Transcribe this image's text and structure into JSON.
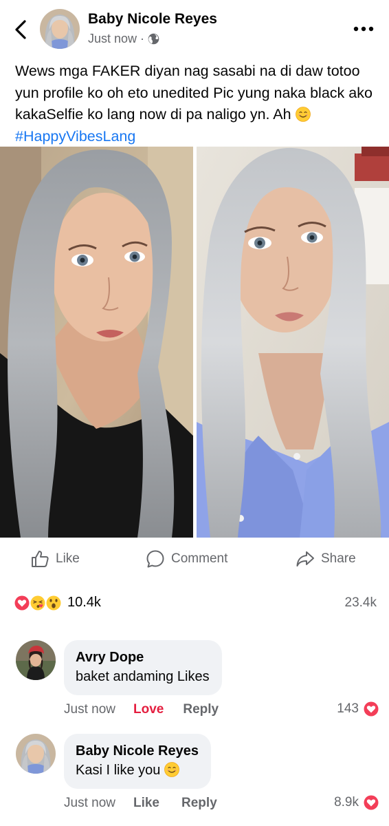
{
  "post": {
    "author_name": "Baby Nicole Reyes",
    "timestamp": "Just now",
    "separator": "·",
    "audience_icon": "globe-icon",
    "text_main": "Wews mga FAKER diyan nag sasabi na di daw totoo yun profile ko oh eto unedited Pic yung naka black ako kakaSelfie ko lang now di pa naligo yn. Ah ",
    "hashtag": "#HappyVibesLang",
    "text_emoji": "smiling-face-emoji"
  },
  "actions": {
    "like_label": "Like",
    "comment_label": "Comment",
    "share_label": "Share"
  },
  "reactions": {
    "icons": [
      "love-icon",
      "kiss-heart-icon",
      "wow-icon"
    ],
    "count": "10.4k",
    "comments_count": "23.4k"
  },
  "comments": [
    {
      "name": "Avry Dope",
      "text": "baket andaming Likes",
      "time": "Just now",
      "reaction_label": "Love",
      "reply_label": "Reply",
      "react_count": "143",
      "react_icon": "love-icon"
    },
    {
      "name": "Baby Nicole Reyes",
      "text": "Kasi I like you ",
      "text_emoji": "smiling-face-emoji",
      "time": "Just now",
      "reaction_label": "Like",
      "reply_label": "Reply",
      "react_count": "8.9k",
      "react_icon": "love-icon"
    }
  ],
  "colors": {
    "brand_blue": "#1877f2",
    "love_red": "#e41e3f",
    "secondary_text": "#65676b",
    "bubble_bg": "#f0f2f5"
  }
}
